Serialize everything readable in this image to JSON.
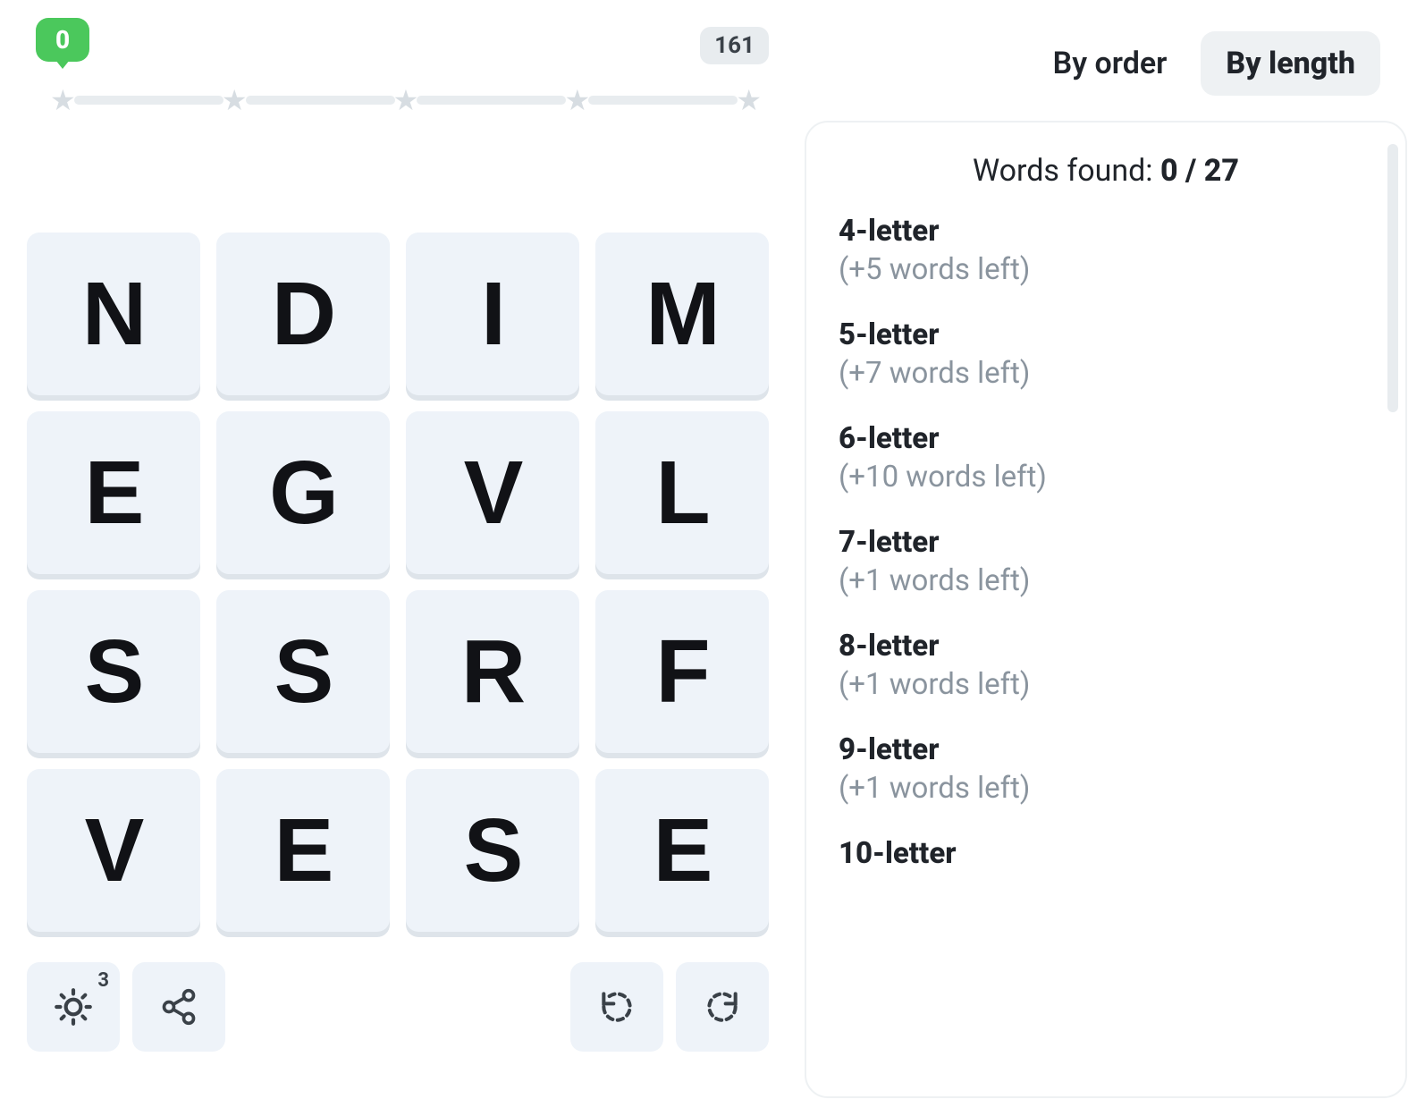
{
  "progress": {
    "score": "0",
    "max_score": "161",
    "stars": 5
  },
  "grid": {
    "rows": [
      [
        "N",
        "D",
        "I",
        "M"
      ],
      [
        "E",
        "G",
        "V",
        "L"
      ],
      [
        "S",
        "S",
        "R",
        "F"
      ],
      [
        "V",
        "E",
        "S",
        "E"
      ]
    ]
  },
  "toolbar": {
    "hint_badge": "3"
  },
  "tabs": {
    "by_order": "By order",
    "by_length": "By length",
    "active": "by_length"
  },
  "results": {
    "found_label": "Words found: ",
    "found_count": "0 / 27",
    "groups": [
      {
        "title": "4-letter",
        "sub": "(+5 words left)"
      },
      {
        "title": "5-letter",
        "sub": "(+7 words left)"
      },
      {
        "title": "6-letter",
        "sub": "(+10 words left)"
      },
      {
        "title": "7-letter",
        "sub": "(+1 words left)"
      },
      {
        "title": "8-letter",
        "sub": "(+1 words left)"
      },
      {
        "title": "9-letter",
        "sub": "(+1 words left)"
      },
      {
        "title": "10-letter",
        "sub": ""
      }
    ]
  }
}
